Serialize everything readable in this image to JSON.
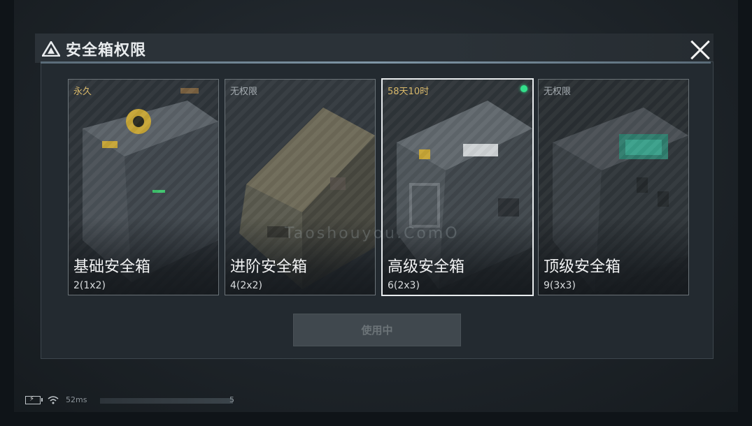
{
  "dialog": {
    "title": "安全箱权限",
    "close_icon": "close-icon"
  },
  "cards": [
    {
      "status": "永久",
      "status_color": "#d8b86a",
      "name": "基础安全箱",
      "capacity": "2(1x2)",
      "selected": false
    },
    {
      "status": "无权限",
      "status_color": "#a5acb1",
      "name": "进阶安全箱",
      "capacity": "4(2x2)",
      "selected": false
    },
    {
      "status": "58天10时",
      "status_color": "#d8b86a",
      "name": "高级安全箱",
      "capacity": "6(2x3)",
      "selected": true
    },
    {
      "status": "无权限",
      "status_color": "#a5acb1",
      "name": "顶级安全箱",
      "capacity": "9(3x3)",
      "selected": false
    }
  ],
  "action": {
    "label": "使用中"
  },
  "system": {
    "ping": "52ms",
    "load_value": "5"
  },
  "watermark": "Taoshouyou.ComO",
  "colors": {
    "accent_green": "#33e08b",
    "accent_gold": "#d8b86a",
    "frame": "#e8ecee"
  }
}
